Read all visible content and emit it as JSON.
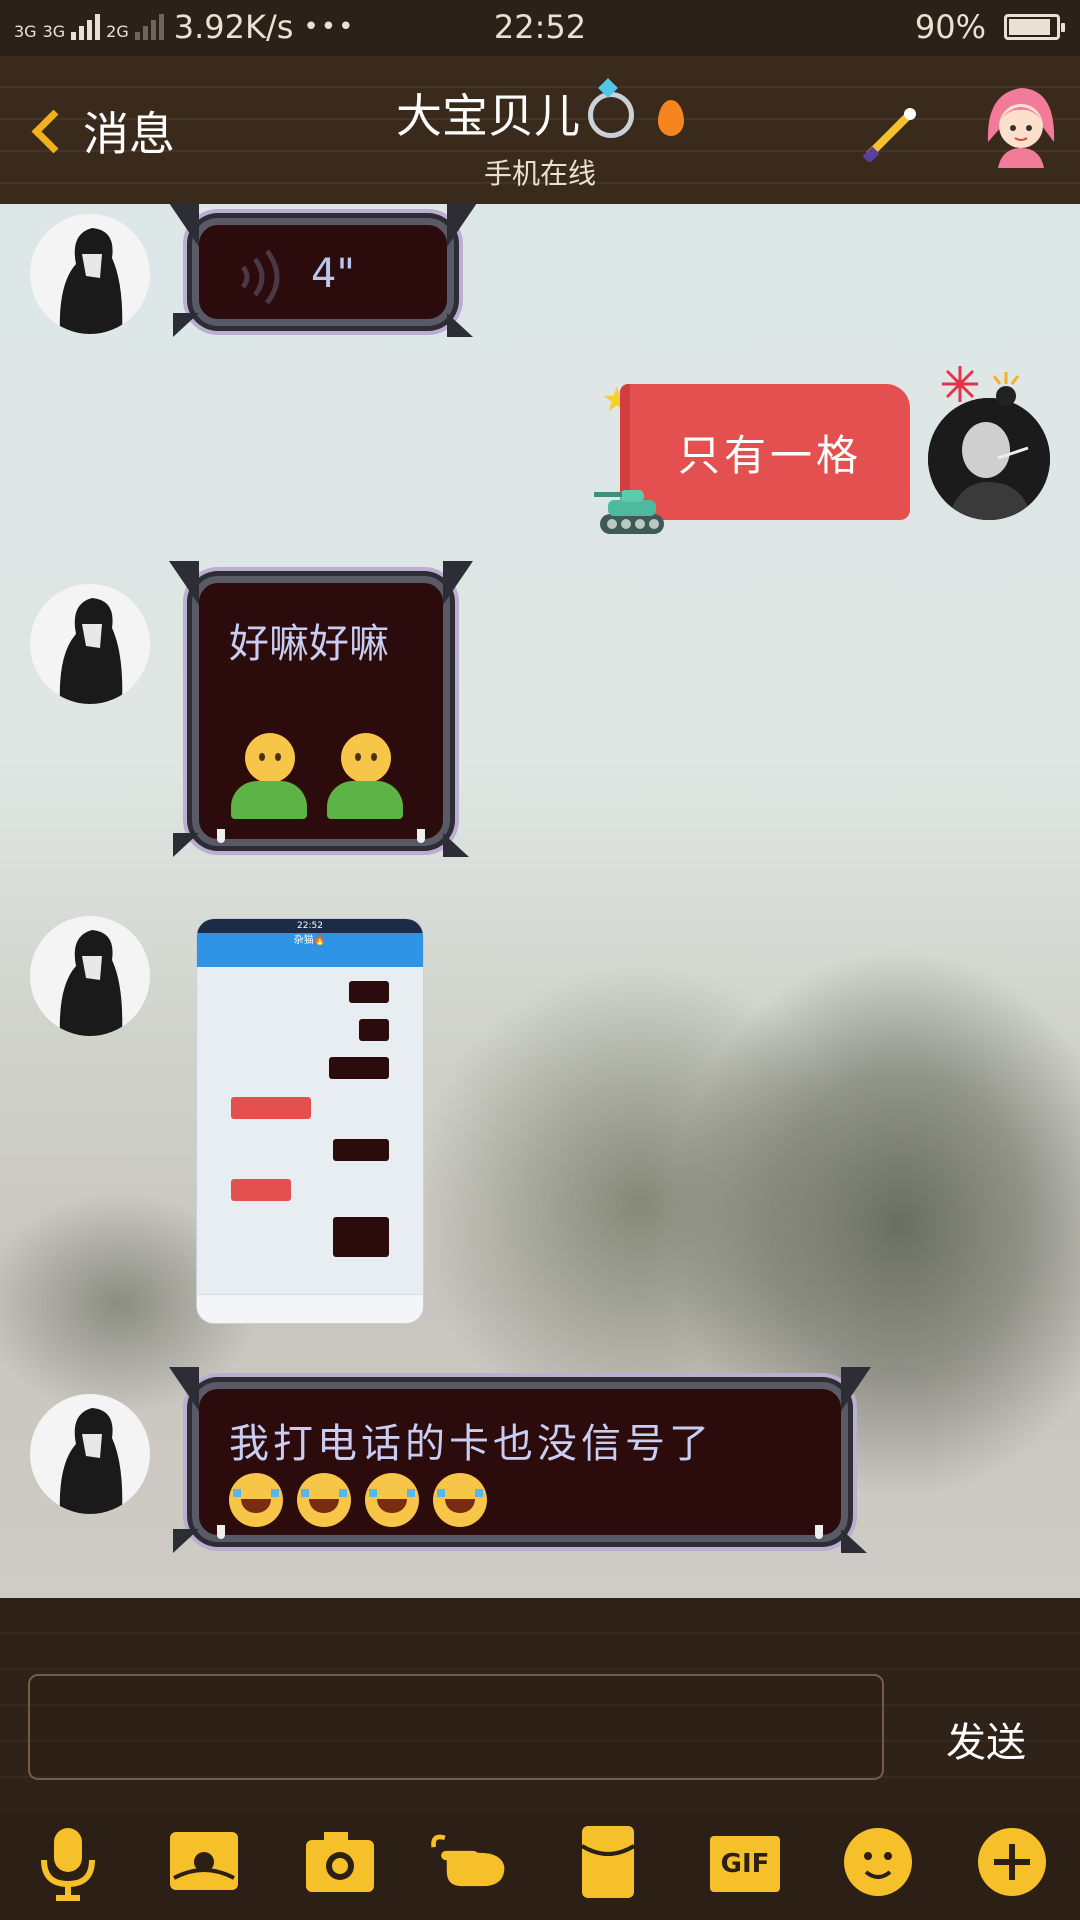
{
  "status_bar": {
    "network_1": "3G",
    "network_2": "3G",
    "network_3": "2G",
    "speed": "3.92K/s",
    "more": "•••",
    "time": "22:52",
    "battery_percent": "90%",
    "battery_level": 0.9
  },
  "header": {
    "back_label": "消息",
    "title": "大宝贝儿",
    "subtitle": "手机在线"
  },
  "messages": [
    {
      "side": "left",
      "type": "voice",
      "duration": "4\""
    },
    {
      "side": "right",
      "type": "text",
      "text": "只有一格"
    },
    {
      "side": "left",
      "type": "text",
      "text": "好嘛好嘛",
      "emoji": "person-icon x2"
    },
    {
      "side": "left",
      "type": "image",
      "thumb_time": "22:52",
      "thumb_title": "杂猫🔥"
    },
    {
      "side": "left",
      "type": "text",
      "text": "我打电话的卡也没信号了",
      "emoji": "tears-of-joy-icon x4"
    }
  ],
  "composer": {
    "send_label": "发送",
    "input_value": ""
  },
  "toolbar": {
    "gif_label": "GIF",
    "items": [
      "microphone-icon",
      "photo-icon",
      "camera-icon",
      "poke-icon",
      "red-packet-icon",
      "gif-icon",
      "emoji-icon",
      "plus-icon"
    ]
  },
  "colors": {
    "accent": "#f6c02a",
    "header_bg": "#3a2a1c",
    "bubble_red": "#e3504f",
    "bubble_dark": "#2b0b0b"
  }
}
